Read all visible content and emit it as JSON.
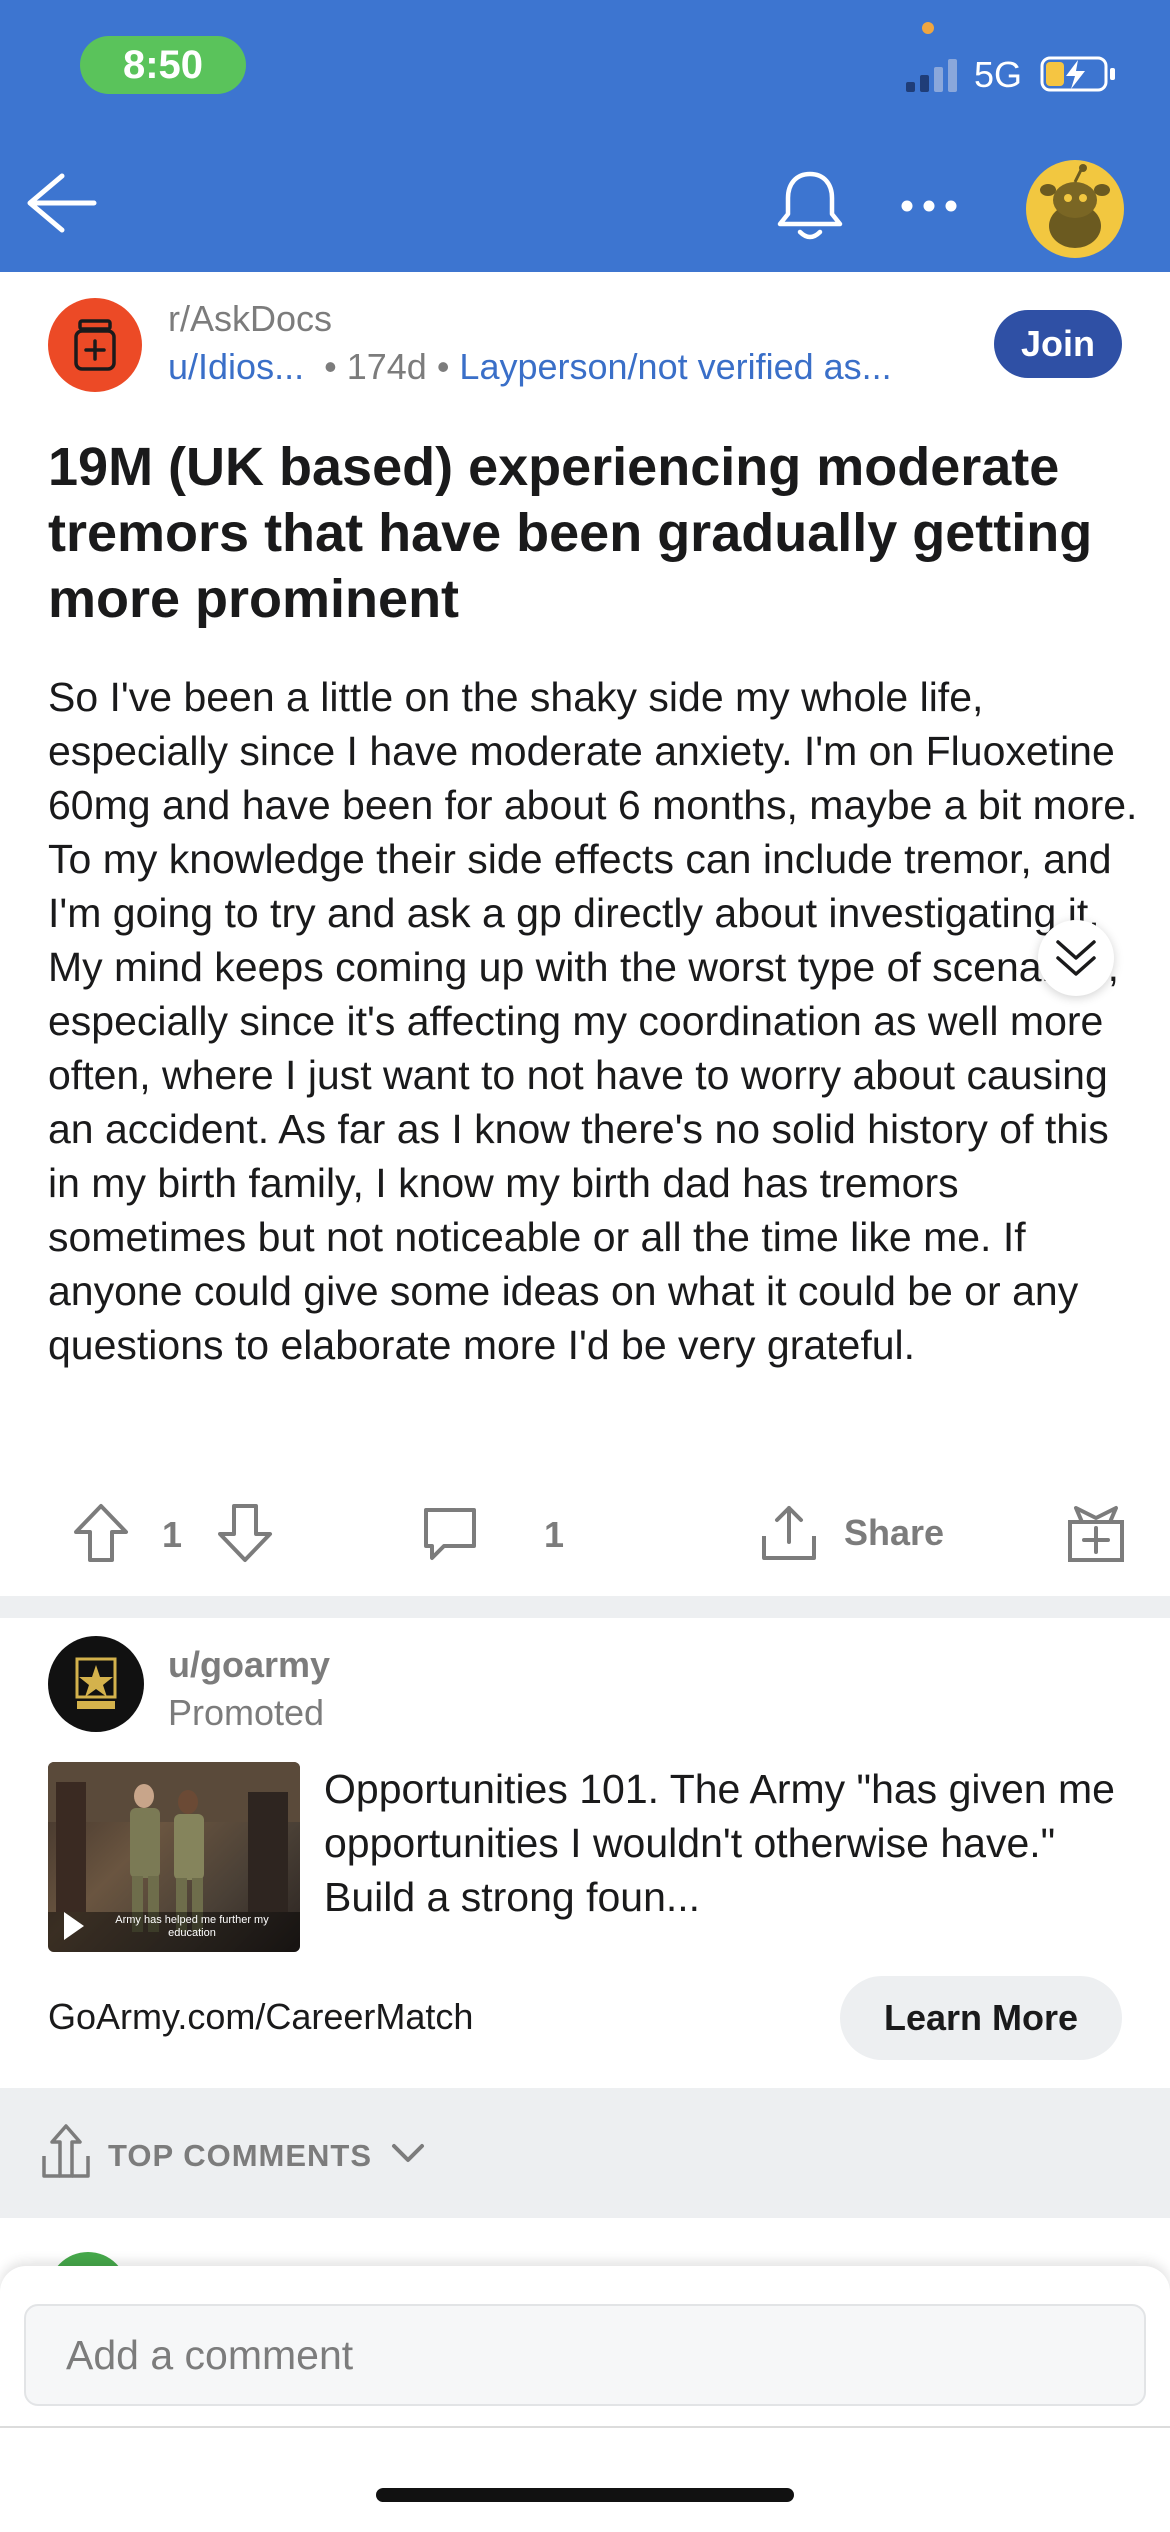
{
  "status_bar": {
    "time": "8:50",
    "network": "5G"
  },
  "post": {
    "subreddit": "r/AskDocs",
    "user": "u/Idios...",
    "age": "174d",
    "flair": "Layperson/not verified as...",
    "join_label": "Join",
    "title": "19M (UK based) experiencing moderate tremors that have been gradually getting more prominent",
    "body": "So I've been a little on the shaky side my whole life, especially since I have moderate anxiety. I'm on Fluoxetine 60mg and have been for about 6 months, maybe a bit more. To my knowledge their side effects can include tremor, and I'm going to try and ask a gp directly about investigating it. My mind keeps coming up with the worst type of scenarios, especially since it's affecting my coordination as well more often, where I just want to not have to worry about causing an accident. As far as I know there's no solid history of this in my birth family, I know my birth dad has tremors sometimes but not noticeable or all the time like me. If anyone could give some ideas on what it could be or any questions to elaborate more I'd be very grateful.",
    "votes": "1",
    "comments": "1",
    "share_label": "Share"
  },
  "ad": {
    "user": "u/goarmy",
    "promoted_label": "Promoted",
    "text": "Opportunities 101. The Army \"has given me opportunities I wouldn't otherwise have.\" Build a strong foun...",
    "thumb_caption": "Army has helped me further my education",
    "link": "GoArmy.com/CareerMatch",
    "cta": "Learn More"
  },
  "comments_section": {
    "sort_label": "TOP COMMENTS"
  },
  "composer": {
    "placeholder": "Add a comment"
  }
}
